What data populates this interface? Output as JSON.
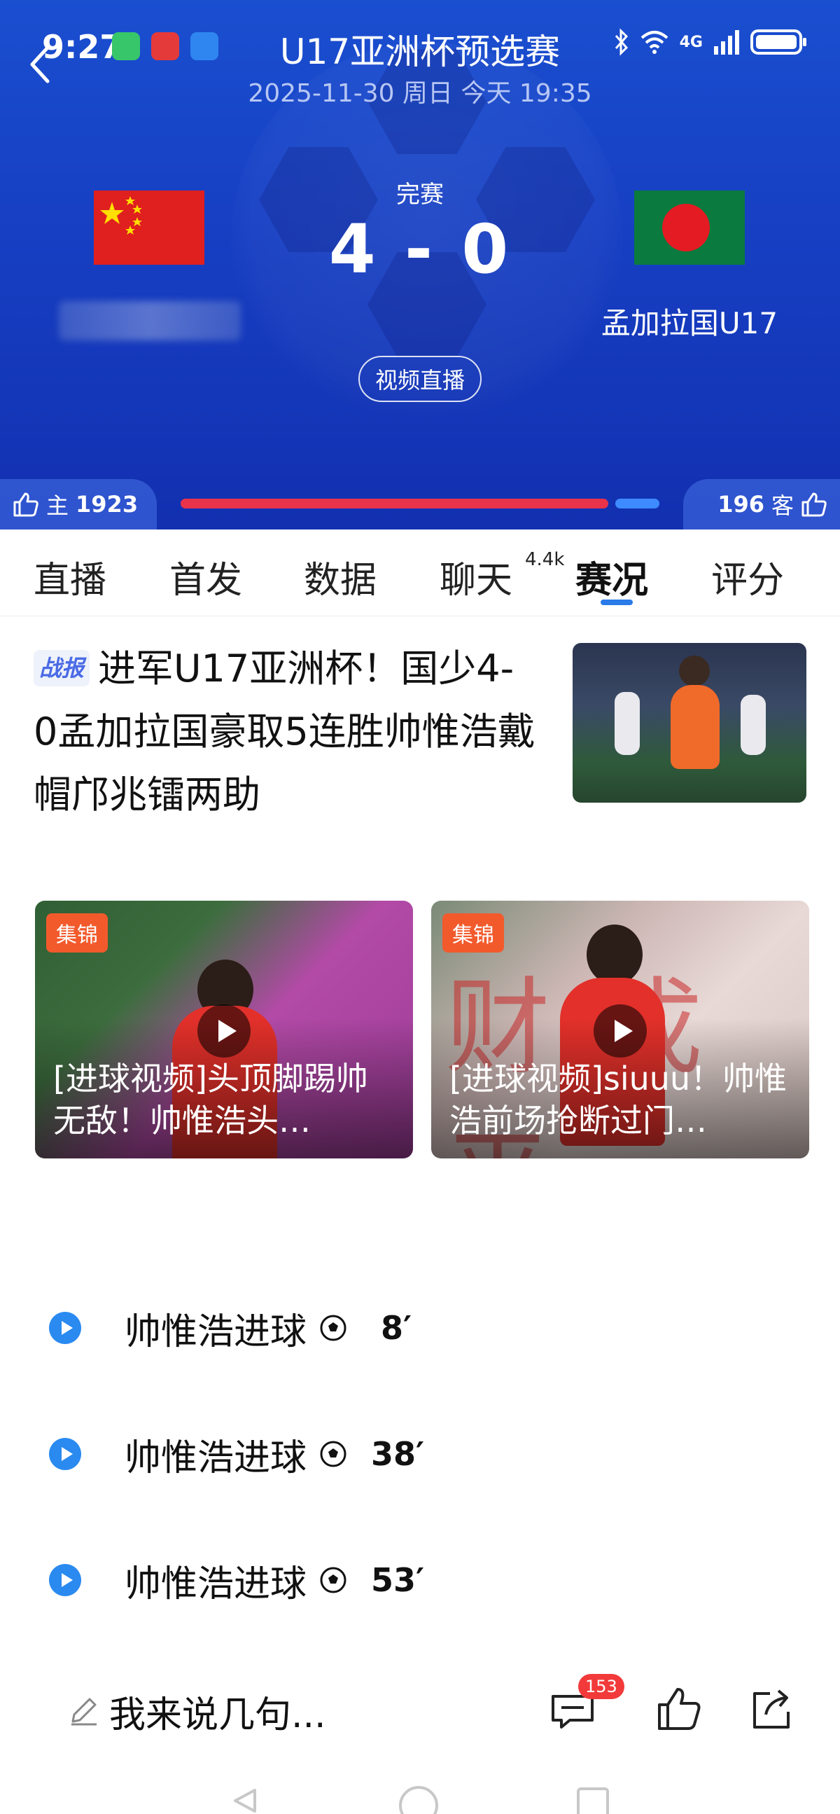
{
  "status_bar": {
    "time": "9:27",
    "network": "4G",
    "bluetooth": "bluetooth-icon",
    "wifi": "wifi-icon",
    "signal": "signal-icon",
    "battery": "battery-icon"
  },
  "match": {
    "title": "U17亚洲杯预选赛",
    "date": "2025-11-30 周日 今天 19:35",
    "status": "完赛",
    "score": "4 - 0",
    "away_team": "孟加拉国U17",
    "live_button": "视频直播"
  },
  "support": {
    "home_label": "主",
    "home_count": "1923",
    "away_count": "196",
    "away_label": "客",
    "home_share": 0.907,
    "colors": {
      "home": "#e8334a",
      "away": "#3d8bff"
    }
  },
  "tabs": [
    {
      "label": "直播"
    },
    {
      "label": "首发"
    },
    {
      "label": "数据"
    },
    {
      "label": "聊天",
      "badge": "4.4k"
    },
    {
      "label": "赛况",
      "active": true
    },
    {
      "label": "评分"
    }
  ],
  "news": {
    "tag": "战报",
    "headline": "进军U17亚洲杯！国少4-0孟加拉国豪取5连胜帅惟浩戴帽邝兆镭两助"
  },
  "videos": [
    {
      "tag": "集锦",
      "title": "[进球视频]头顶脚踢帅无敌！帅惟浩头…"
    },
    {
      "tag": "集锦",
      "title": "[进球视频]siuuu！帅惟浩前场抢断过门…"
    }
  ],
  "events": [
    {
      "text": "帅惟浩进球",
      "minute": "8′"
    },
    {
      "text": "帅惟浩进球",
      "minute": "38′"
    },
    {
      "text": "帅惟浩进球",
      "minute": "53′"
    }
  ],
  "comment_bar": {
    "placeholder": "我来说几句...",
    "comment_count": "153"
  },
  "theme": {
    "hero_blue": "#1740c4",
    "accent_blue": "#2a7ae8",
    "badge_red": "#f23a3a",
    "tag_orange": "#f25a2c"
  }
}
